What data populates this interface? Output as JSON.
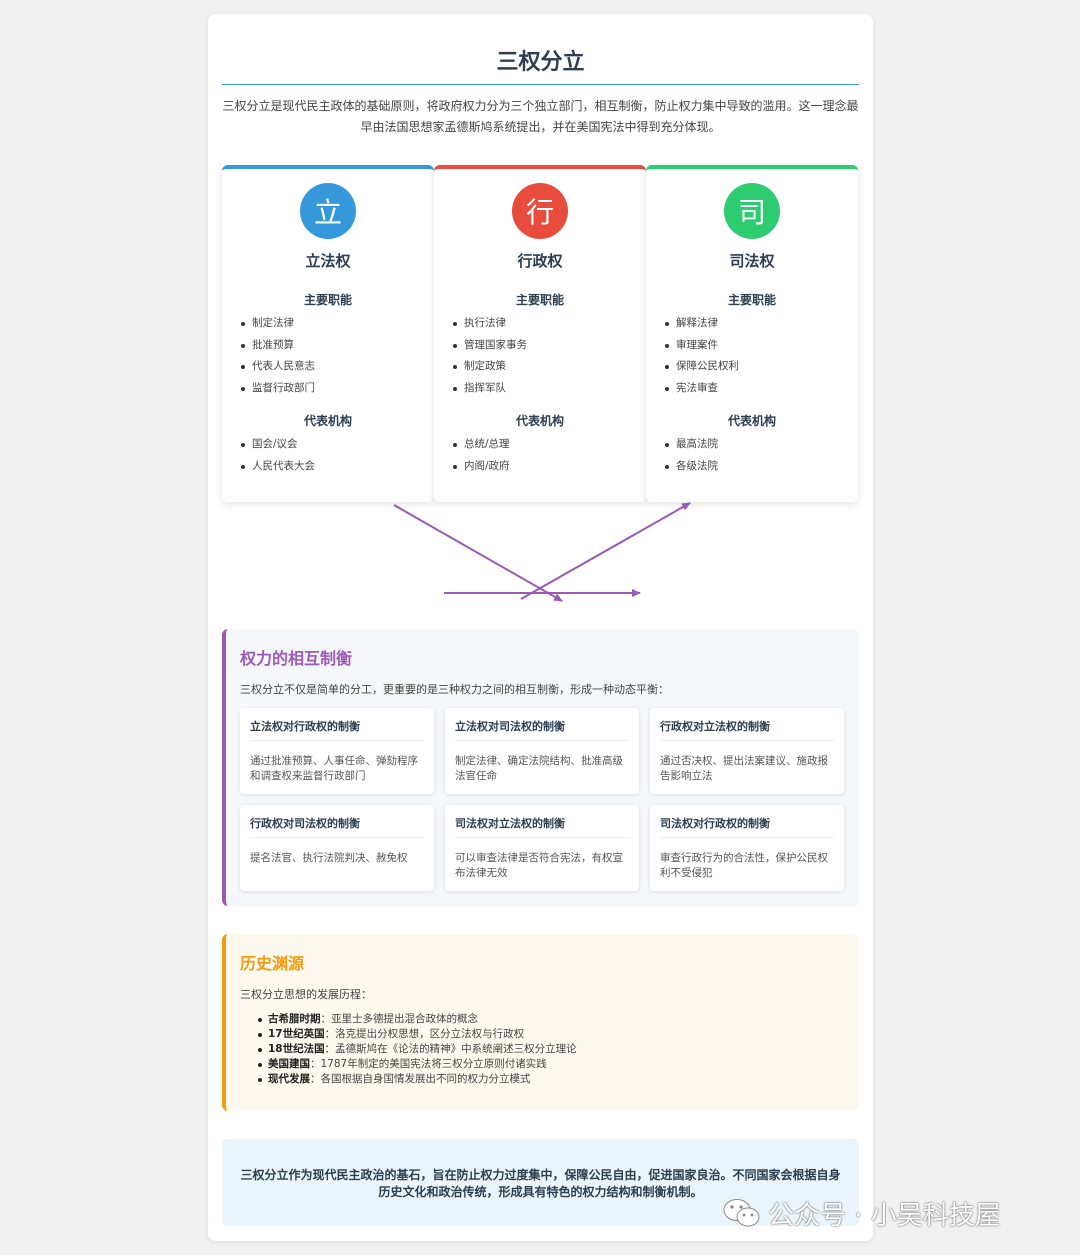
{
  "title": "三权分立",
  "intro": "三权分立是现代民主政体的基础原则，将政府权力分为三个独立部门，相互制衡，防止权力集中导致的滥用。这一理念最早由法国思想家孟德斯鸠系统提出，并在美国宪法中得到充分体现。",
  "branches": [
    {
      "icon_char": "立",
      "name": "立法权",
      "color": "#3498db",
      "functions_title": "主要职能",
      "functions": [
        "制定法律",
        "批准预算",
        "代表人民意志",
        "监督行政部门"
      ],
      "institutions_title": "代表机构",
      "institutions": [
        "国会/议会",
        "人民代表大会"
      ]
    },
    {
      "icon_char": "行",
      "name": "行政权",
      "color": "#e74c3c",
      "functions_title": "主要职能",
      "functions": [
        "执行法律",
        "管理国家事务",
        "制定政策",
        "指挥军队"
      ],
      "institutions_title": "代表机构",
      "institutions": [
        "总统/总理",
        "内阁/政府"
      ]
    },
    {
      "icon_char": "司",
      "name": "司法权",
      "color": "#2ecc71",
      "functions_title": "主要职能",
      "functions": [
        "解释法律",
        "审理案件",
        "保障公民权利",
        "宪法审查"
      ],
      "institutions_title": "代表机构",
      "institutions": [
        "最高法院",
        "各级法院"
      ]
    }
  ],
  "checks": {
    "title": "权力的相互制衡",
    "title_color": "#9b59b6",
    "description": "三权分立不仅是简单的分工，更重要的是三种权力之间的相互制衡，形成一种动态平衡：",
    "cards": [
      {
        "title": "立法权对行政权的制衡",
        "desc": "通过批准预算、人事任命、弹劾程序和调查权来监督行政部门"
      },
      {
        "title": "立法权对司法权的制衡",
        "desc": "制定法律、确定法院结构、批准高级法官任命"
      },
      {
        "title": "行政权对立法权的制衡",
        "desc": "通过否决权、提出法案建议、施政报告影响立法"
      },
      {
        "title": "行政权对司法权的制衡",
        "desc": "提名法官、执行法院判决、赦免权"
      },
      {
        "title": "司法权对立法权的制衡",
        "desc": "可以审查法律是否符合宪法，有权宣布法律无效"
      },
      {
        "title": "司法权对行政权的制衡",
        "desc": "审查行政行为的合法性，保护公民权利不受侵犯"
      }
    ]
  },
  "history": {
    "title": "历史渊源",
    "title_color": "#f39c12",
    "description": "三权分立思想的发展历程：",
    "items": [
      {
        "era": "古希腊时期",
        "text": "：亚里士多德提出混合政体的概念"
      },
      {
        "era": "17世纪英国",
        "text": "：洛克提出分权思想，区分立法权与行政权"
      },
      {
        "era": "18世纪法国",
        "text": "：孟德斯鸠在《论法的精神》中系统阐述三权分立理论"
      },
      {
        "era": "美国建国",
        "text": "：1787年制定的美国宪法将三权分立原则付诸实践"
      },
      {
        "era": "现代发展",
        "text": "：各国根据自身国情发展出不同的权力分立模式"
      }
    ]
  },
  "conclusion": "三权分立作为现代民主政治的基石，旨在防止权力过度集中，保障公民自由，促进国家良治。不同国家会根据自身历史文化和政治传统，形成具有特色的权力结构和制衡机制。",
  "watermark": {
    "icon": "wechat-icon",
    "text": "公众号 · 小吴科技屋"
  },
  "arrow_color": "#9b59b6"
}
